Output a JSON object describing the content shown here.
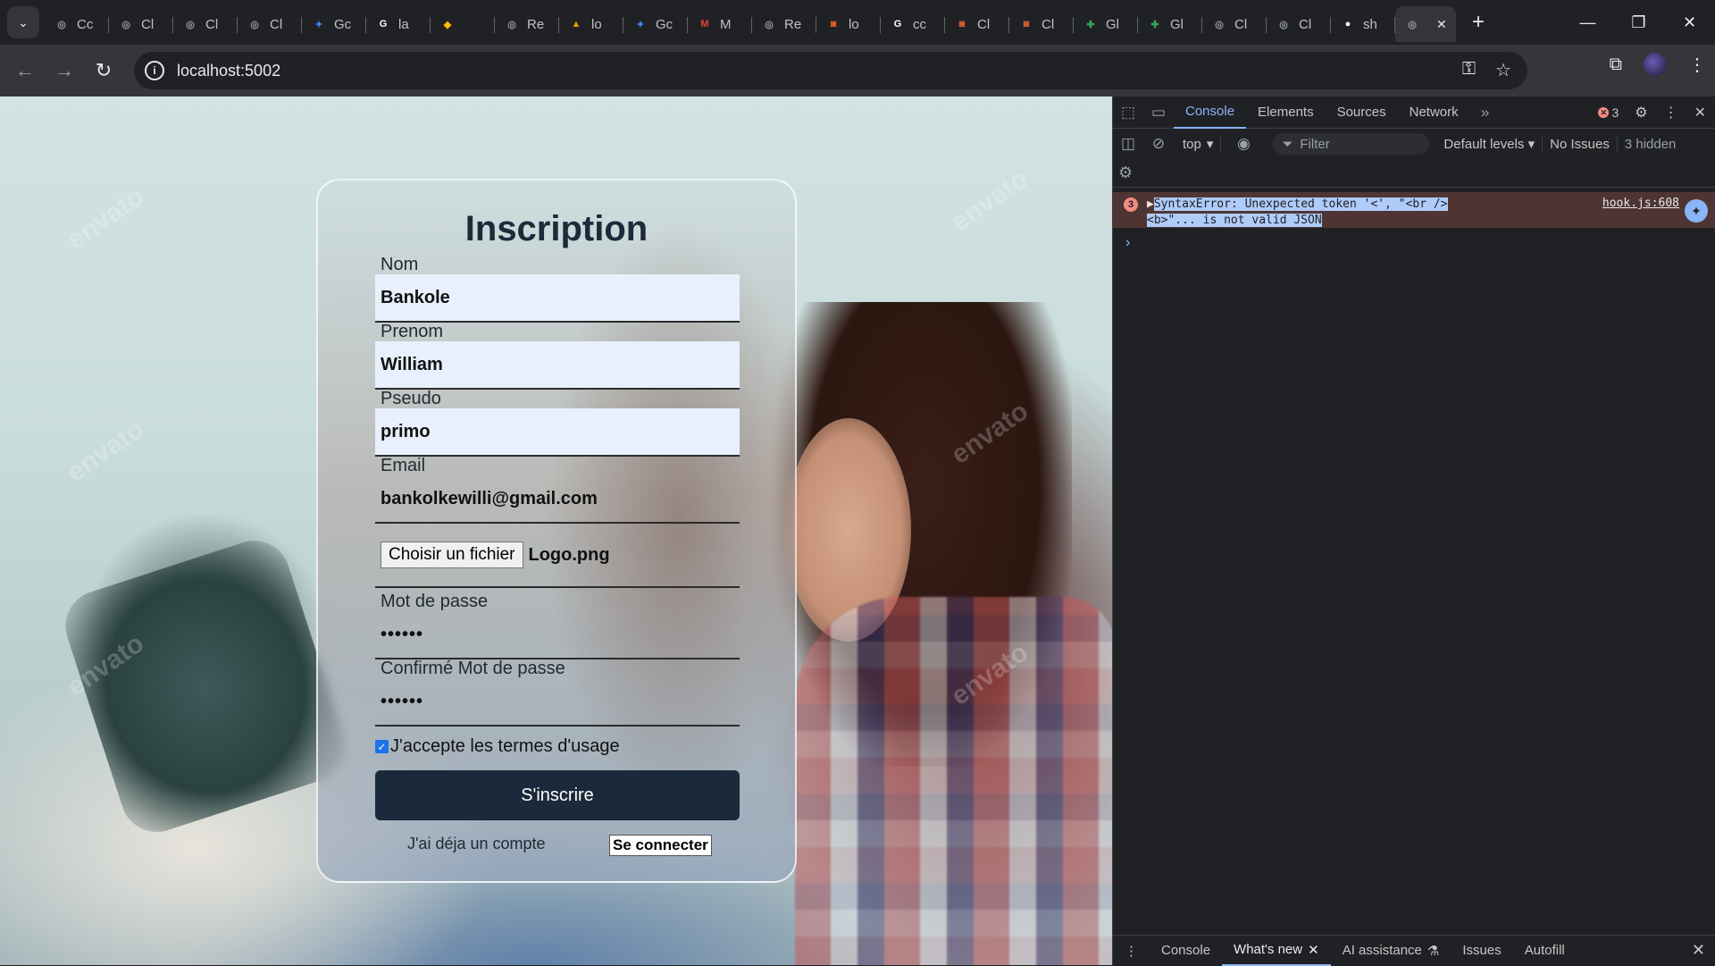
{
  "browser": {
    "tabs": [
      {
        "label": "Cc",
        "icon": "chatgpt-icon",
        "color": "#9aa0a6"
      },
      {
        "label": "Cl",
        "icon": "chatgpt-icon",
        "color": "#9aa0a6"
      },
      {
        "label": "Cl",
        "icon": "chatgpt-icon",
        "color": "#9aa0a6"
      },
      {
        "label": "Cl",
        "icon": "chatgpt-icon",
        "color": "#9aa0a6"
      },
      {
        "label": "Gc",
        "icon": "gemini-icon",
        "color": "#4285f4"
      },
      {
        "label": "la",
        "icon": "google-icon",
        "color": "#ffffff"
      },
      {
        "label": "",
        "icon": "extension-icon",
        "color": "#fbbc04"
      },
      {
        "label": "Re",
        "icon": "chatgpt-icon",
        "color": "#9aa0a6"
      },
      {
        "label": "lo",
        "icon": "orange-logo-icon",
        "color": "#f29900"
      },
      {
        "label": "Gc",
        "icon": "gemini-icon",
        "color": "#4285f4"
      },
      {
        "label": "M",
        "icon": "gmail-icon",
        "color": "#ea4335"
      },
      {
        "label": "Re",
        "icon": "chatgpt-icon",
        "color": "#9aa0a6"
      },
      {
        "label": "lo",
        "icon": "codeigniter-icon",
        "color": "#f26522"
      },
      {
        "label": "cc",
        "icon": "google-icon",
        "color": "#ffffff"
      },
      {
        "label": "Cl",
        "icon": "codeigniter-icon",
        "color": "#f26522"
      },
      {
        "label": "Cl",
        "icon": "codeigniter-icon",
        "color": "#f26522"
      },
      {
        "label": "Gl",
        "icon": "sheets-icon",
        "color": "#34a853"
      },
      {
        "label": "Gl",
        "icon": "sheets-icon",
        "color": "#34a853"
      },
      {
        "label": "Cl",
        "icon": "chatgpt-icon",
        "color": "#9aa0a6"
      },
      {
        "label": "Cl",
        "icon": "chatgpt-icon",
        "color": "#9aa0a6"
      },
      {
        "label": "sh",
        "icon": "github-icon",
        "color": "#ffffff"
      }
    ],
    "active_tab_close": "✕",
    "new_tab": "+",
    "url": "localhost:5002"
  },
  "form": {
    "title": "Inscription",
    "nom_label": "Nom",
    "nom_value": "Bankole",
    "prenom_label": "Prenom",
    "prenom_value": "William",
    "pseudo_label": "Pseudo",
    "pseudo_value": "primo",
    "email_label": "Email",
    "email_value": "bankolkewilli@gmail.com",
    "file_button": "Choisir un fichier",
    "file_name": "Logo.png",
    "password_label": "Mot de passe",
    "password_value": "••••••",
    "confirm_label": "Confirmé Mot de passe",
    "confirm_value": "••••••",
    "terms_label": "J'accepte les termes d'usage",
    "terms_checked": true,
    "submit_label": "S'inscrire",
    "have_account": "J'ai déja un compte",
    "login_label": "Se connecter"
  },
  "devtools": {
    "tabs": [
      "Console",
      "Elements",
      "Sources",
      "Network"
    ],
    "active_tab": "Console",
    "error_count": "3",
    "context": "top",
    "filter_placeholder": "Filter",
    "levels": "Default levels",
    "issues": "No Issues",
    "hidden": "3 hidden",
    "error": {
      "count": "3",
      "text_line1": "SyntaxError: Unexpected token '<', \"<br />",
      "text_line2": "<b>\"... is not valid JSON",
      "source": "hook.js:608"
    },
    "drawer_tabs": [
      "Console",
      "What's new",
      "AI assistance",
      "Issues",
      "Autofill"
    ],
    "drawer_active": "What's new"
  },
  "watermark": "envato",
  "colors": {
    "submit_bg": "#1b2a3a",
    "error_bg": "#4e3534",
    "devtools_accent": "#8ab4f8"
  }
}
